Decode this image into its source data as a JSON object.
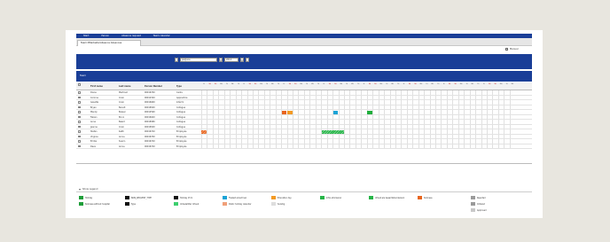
{
  "nav": [
    "Start",
    "Person",
    "Absence request",
    "Team calendar"
  ],
  "tab": {
    "label": "Team MitarbeiterAbsence Absences"
  },
  "manual_label": "Manual",
  "period": {
    "month": "Juli/June",
    "year": "2014"
  },
  "section_label": "Team",
  "headers": {
    "first": "First name",
    "last": "Last name",
    "pnum": "Person Number",
    "type": "Type"
  },
  "day_headers": [
    "Fr",
    "Sa",
    "Su",
    "Mo",
    "Tu",
    "We",
    "Th",
    "Fr",
    "Sa",
    "Su",
    "Mo",
    "Tu",
    "We",
    "Th",
    "Fr",
    "Sa",
    "Su",
    "Mo",
    "Tu",
    "We",
    "Th",
    "Fr",
    "Sa",
    "Su",
    "Mo",
    "Tu",
    "We",
    "Th",
    "Fr",
    "Sa",
    "Su",
    "Mo",
    "Tu",
    "We",
    "Th",
    "Fr",
    "Sa",
    "Su",
    "Mo",
    "Tu",
    "We",
    "Th",
    "Fr",
    "Sa",
    "Su",
    "Mo",
    "Tu",
    "We",
    "Th",
    "Fr",
    "Sa",
    "Su",
    "Mo",
    "Tu",
    "We"
  ],
  "rows": [
    {
      "first": "Diana",
      "last": "Martinet",
      "pnum": "00016700",
      "type": "Cadre"
    },
    {
      "first": "Corinne",
      "last": "Crain",
      "pnum": "00012320",
      "type": "Apprentice"
    },
    {
      "first": "Gosette",
      "last": "Crain",
      "pnum": "00016900",
      "type": "Intérim"
    },
    {
      "first": "Bryan",
      "last": "Benoit",
      "pnum": "00016500",
      "type": "Collègue"
    },
    {
      "first": "Mandy",
      "last": "Bossel",
      "pnum": "00012590",
      "type": "Collègue"
    },
    {
      "first": "Fabien",
      "last": "Bruni",
      "pnum": "00016920",
      "type": "Collègue"
    },
    {
      "first": "Anna",
      "last": "Baard",
      "pnum": "00016580",
      "type": "Collègue"
    },
    {
      "first": "Jeanne",
      "last": "Crain",
      "pnum": "00016500",
      "type": "Collègue"
    },
    {
      "first": "Stefan",
      "last": "Kaith",
      "pnum": "00016720",
      "type": "Employée"
    },
    {
      "first": "Virginie",
      "last": "Arnou",
      "pnum": "00016700",
      "type": "Employée"
    },
    {
      "first": "Emilie",
      "last": "Suerin",
      "pnum": "00016720",
      "type": "Employée"
    },
    {
      "first": "Dave",
      "last": "Arnou",
      "pnum": "00016720",
      "type": "Employée"
    }
  ],
  "highlights": [
    {
      "row": 4,
      "start": 14,
      "len": 1,
      "color": "#e8651e",
      "stripe": false
    },
    {
      "row": 4,
      "start": 15,
      "len": 1,
      "color": "#f39a24",
      "stripe": false
    },
    {
      "row": 4,
      "start": 23,
      "len": 1,
      "color": "#1aa3d6",
      "stripe": false
    },
    {
      "row": 4,
      "start": 29,
      "len": 1,
      "color": "#1fae3c",
      "stripe": false
    },
    {
      "row": 8,
      "start": 0,
      "len": 1,
      "color": "#e8651e",
      "stripe": true
    },
    {
      "row": 8,
      "start": 21,
      "len": 4,
      "color": "#26b548",
      "stripe": true
    }
  ],
  "legend_title": "Show Legend",
  "legend": [
    {
      "label": "Holiday",
      "color": "#1f9e3a",
      "col": 0,
      "line": 0
    },
    {
      "label": "Sickness without hospital",
      "color": "#1f9e3a",
      "col": 0,
      "line": 1
    },
    {
      "label": "NON_REQUEST_TYPE",
      "color": "#111111",
      "col": 1,
      "line": 0
    },
    {
      "label": "Type",
      "color": "#111111",
      "col": 1,
      "line": 1
    },
    {
      "label": "Holiday 15:9",
      "color": "#111111",
      "col": 2,
      "line": 0
    },
    {
      "label": "Unbezahlter Urlaub",
      "color": "#3ecf6f",
      "col": 2,
      "line": 1
    },
    {
      "label": "Freizeit anrechnen",
      "color": "#1aa3d6",
      "col": 3,
      "line": 0
    },
    {
      "label": "Public holiday calendar",
      "color": "#f0a07a",
      "col": 3,
      "line": 1
    },
    {
      "label": "Education day",
      "color": "#f39a24",
      "col": 4,
      "line": 0
    },
    {
      "label": "Sonstig",
      "color": "#dddddd",
      "col": 4,
      "line": 1
    },
    {
      "label": "Infos stornieren",
      "color": "#26b548",
      "col": 5,
      "line": 0
    },
    {
      "label": "Urlaub als Gesamtstundenanz",
      "color": "#26b548",
      "col": 6,
      "line": 0
    },
    {
      "label": "Sickness",
      "color": "#e8651e",
      "col": 7,
      "line": 0
    },
    {
      "label": "Rejected",
      "color": "#9a9a9a",
      "col": 8,
      "line": 0
    },
    {
      "label": "Ordered",
      "color": "#9a9a9a",
      "col": 8,
      "line": 1
    },
    {
      "label": "Approved",
      "color": "#c8c8c8",
      "col": 8,
      "line": 2
    }
  ]
}
